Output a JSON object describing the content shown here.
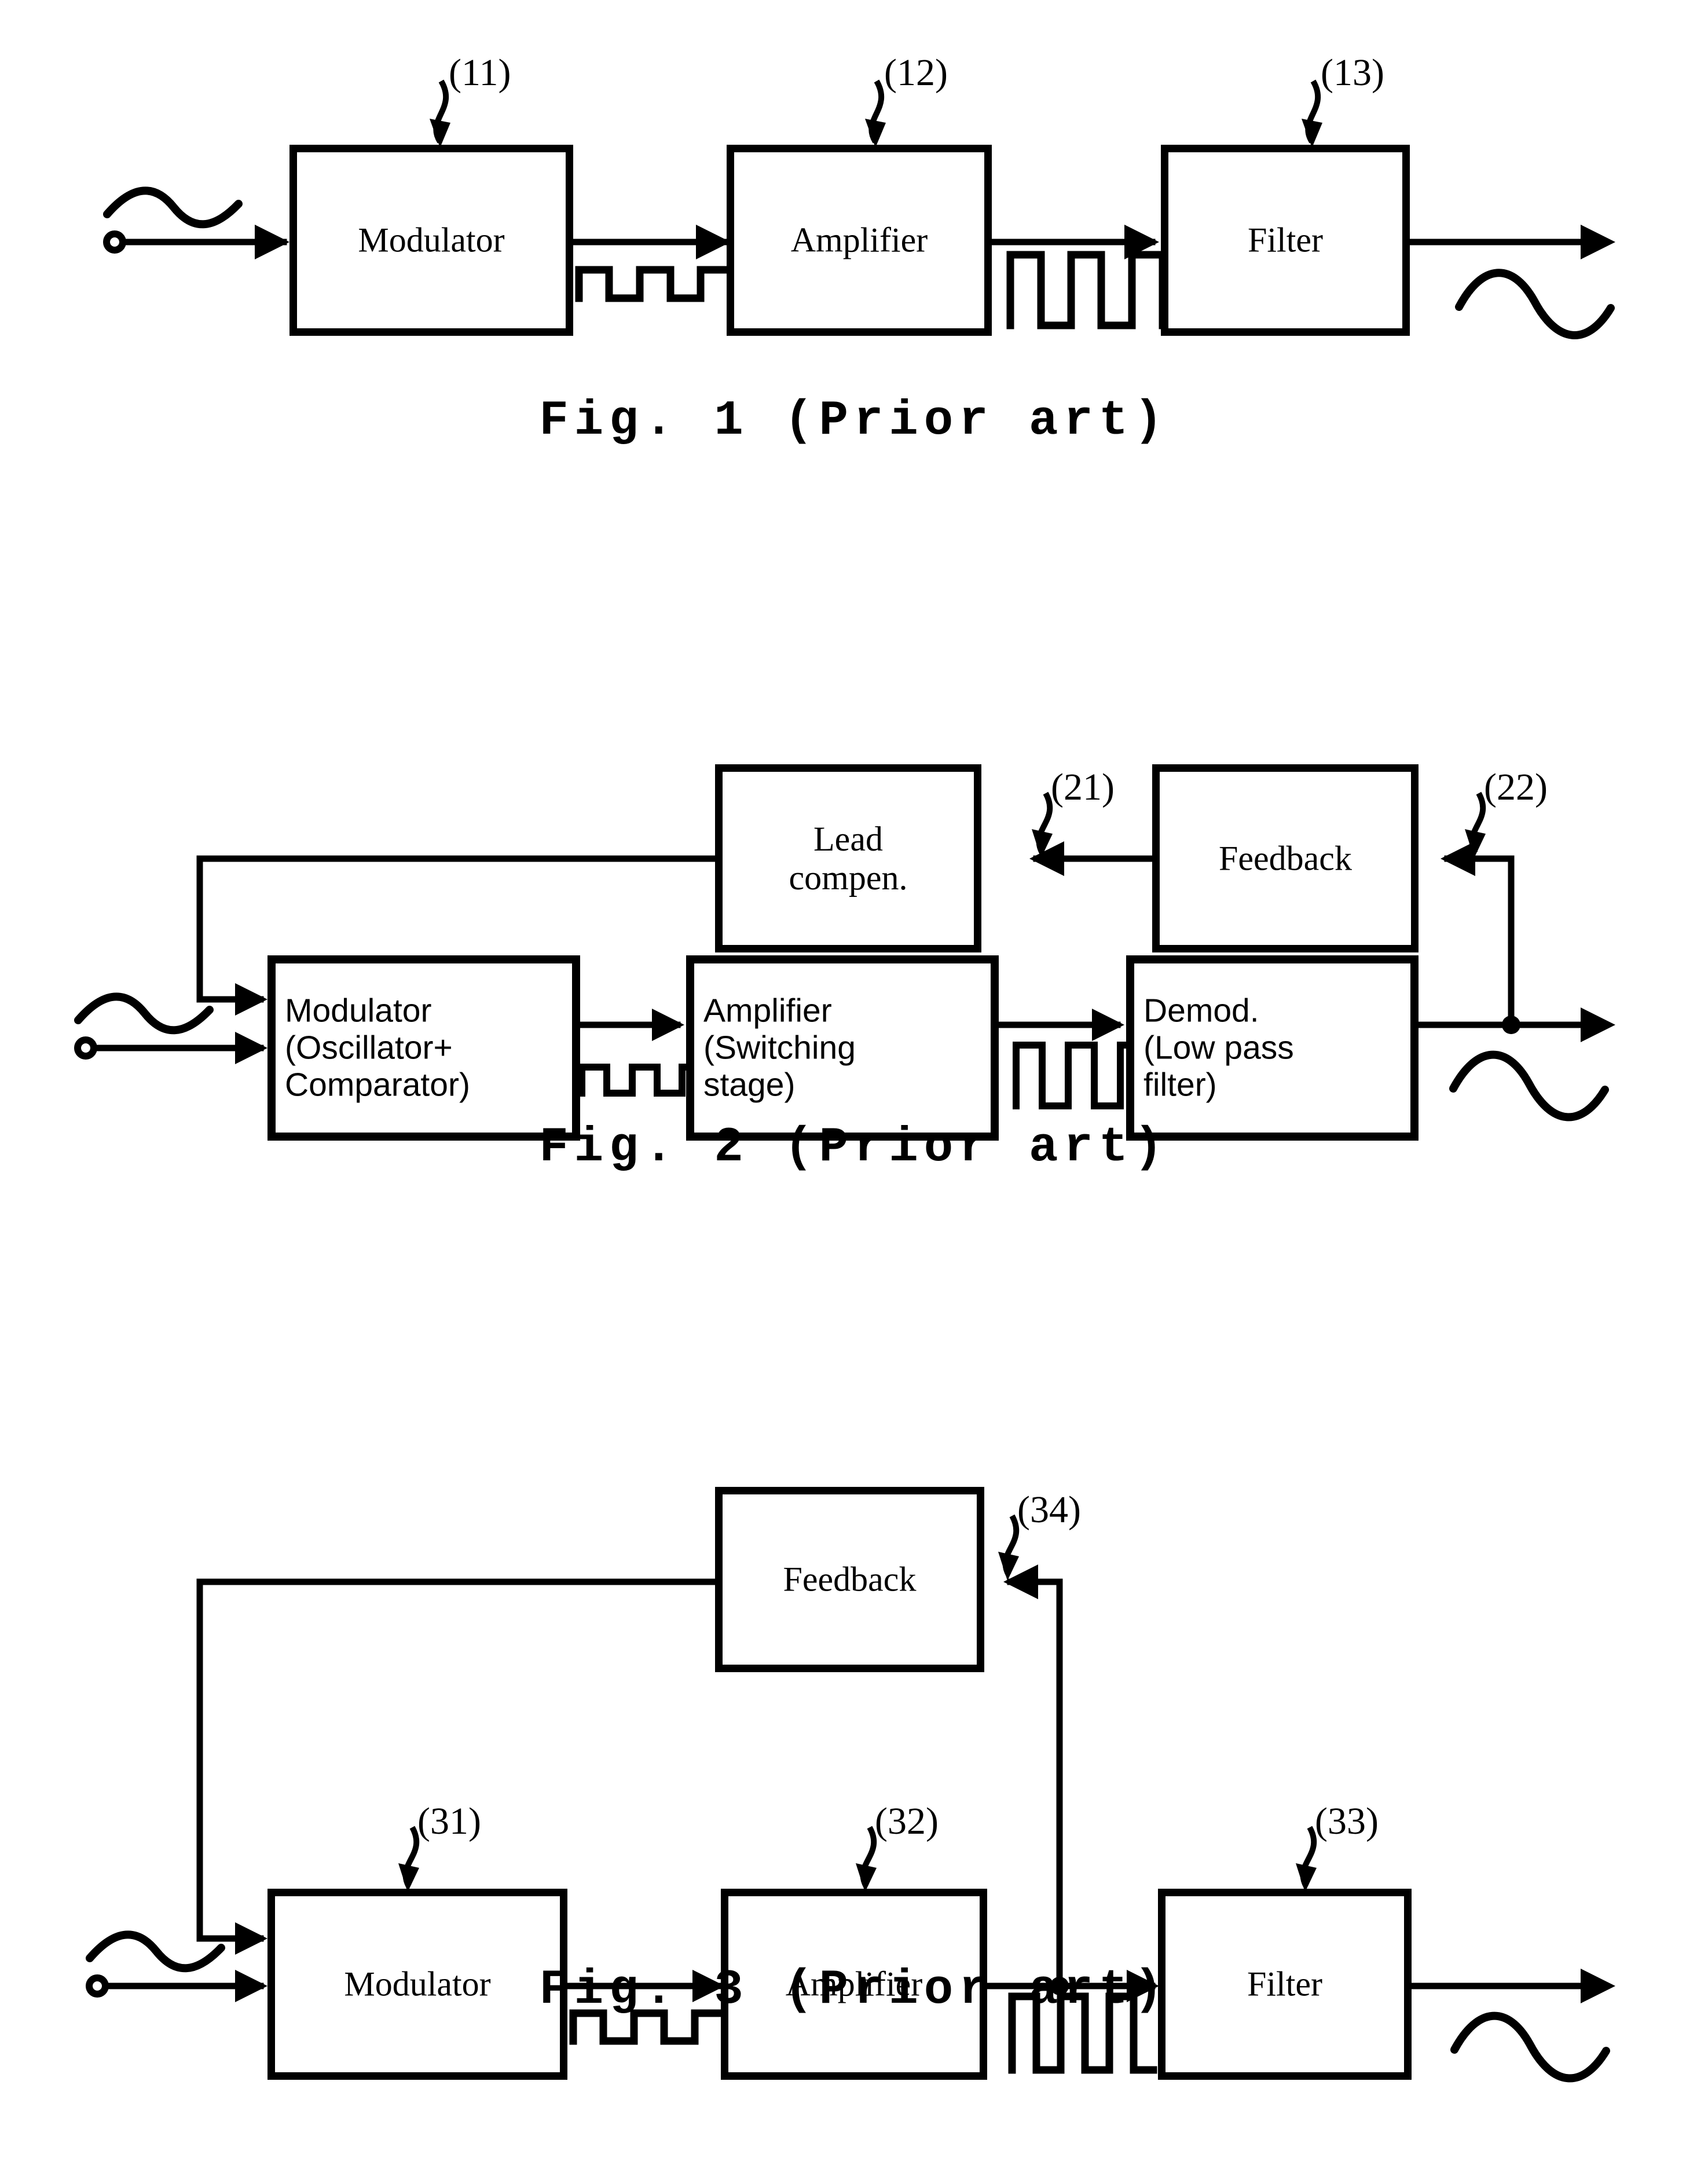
{
  "document": {
    "type": "patent-block-diagrams",
    "page_background": "#ffffff",
    "ink_color": "#000000"
  },
  "figures": [
    {
      "id": "fig1",
      "caption": "Fig. 1 (Prior art)",
      "input_terminal": "open-circle-terminal",
      "input_waveform": "sine",
      "blocks": [
        {
          "label": "Modulator",
          "ref": "(11)",
          "font": "serif"
        },
        {
          "label": "Amplifier",
          "ref": "(12)",
          "font": "serif"
        },
        {
          "label": "Filter",
          "ref": "(13)",
          "font": "serif"
        }
      ],
      "interconnect_waveforms": [
        "square-pwm",
        "square-pwm-amplified"
      ],
      "output_waveform": "sine",
      "feedback": false
    },
    {
      "id": "fig2",
      "caption": "Fig. 2 (Prior art)",
      "input_terminal": "open-circle-terminal",
      "input_waveform": "sine",
      "top_blocks": [
        {
          "label_lines": [
            "Lead",
            "compen."
          ],
          "ref": "(21)",
          "font": "serif"
        },
        {
          "label_lines": [
            "Feedback"
          ],
          "ref": "(22)",
          "font": "serif"
        }
      ],
      "blocks": [
        {
          "label_lines": [
            "Modulator",
            "(Oscillator+",
            "Comparator)"
          ],
          "font": "sans"
        },
        {
          "label_lines": [
            "Amplifier",
            "(Switching",
            "stage)"
          ],
          "font": "sans"
        },
        {
          "label_lines": [
            "Demod.",
            "(Low pass",
            "filter)"
          ],
          "font": "sans"
        }
      ],
      "interconnect_waveforms": [
        "square-pwm",
        "square-pwm-amplified"
      ],
      "output_waveform": "sine",
      "feedback": true,
      "feedback_path": "output-tap -> Feedback -> Lead compen. -> Modulator upper input"
    },
    {
      "id": "fig3",
      "caption": "Fig. 3 (Prior art)",
      "input_terminal": "open-circle-terminal",
      "input_waveform": "sine",
      "top_blocks": [
        {
          "label_lines": [
            "Feedback"
          ],
          "ref": "(34)",
          "font": "serif"
        }
      ],
      "blocks": [
        {
          "label": "Modulator",
          "ref": "(31)",
          "font": "serif"
        },
        {
          "label": "Amplifier",
          "ref": "(32)",
          "font": "serif"
        },
        {
          "label": "Filter",
          "ref": "(33)",
          "font": "serif"
        }
      ],
      "interconnect_waveforms": [
        "square-pwm",
        "square-pwm-amplified"
      ],
      "output_waveform": "sine",
      "feedback": true,
      "feedback_path": "tap between Amplifier and Filter -> Feedback -> Modulator upper input"
    }
  ]
}
